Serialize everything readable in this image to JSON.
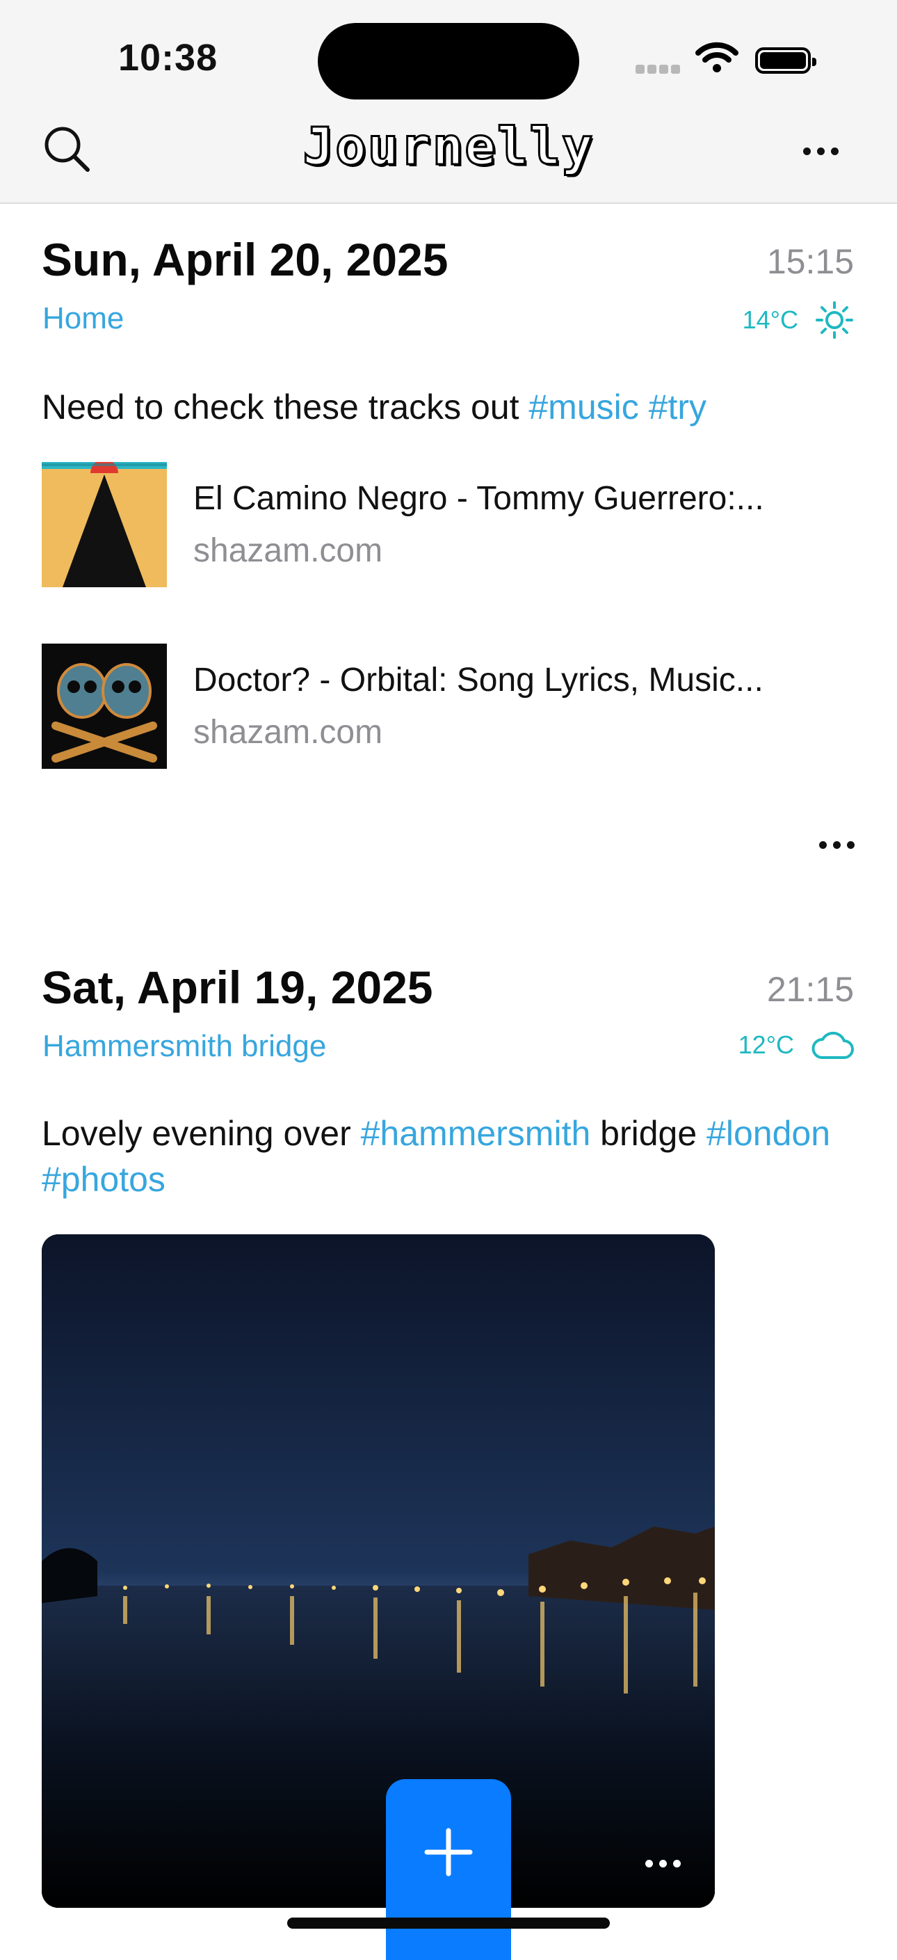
{
  "status_bar": {
    "time": "10:38"
  },
  "header": {
    "title": "Journelly"
  },
  "entries": [
    {
      "date": "Sun, April 20, 2025",
      "time": "15:15",
      "location": "Home",
      "weather": {
        "temperature": "14°C",
        "icon": "sun-icon"
      },
      "text_parts": [
        "Need to check these tracks out ",
        "#music",
        " ",
        "#try"
      ],
      "links": [
        {
          "title": "El Camino Negro - Tommy Guerrero:...",
          "domain": "shazam.com"
        },
        {
          "title": "Doctor? - Orbital: Song Lyrics, Music...",
          "domain": "shazam.com"
        }
      ]
    },
    {
      "date": "Sat, April 19, 2025",
      "time": "21:15",
      "location": "Hammersmith bridge",
      "weather": {
        "temperature": "12°C",
        "icon": "cloud-icon"
      },
      "text_parts": [
        "Lovely evening over ",
        "#hammersmith",
        " bridge ",
        "#london",
        "#photos"
      ]
    }
  ],
  "colors": {
    "accent": "#37a6de",
    "weather": "#1fb8c1",
    "fab": "#0a7cff"
  },
  "fab": {
    "icon": "plus-icon"
  }
}
